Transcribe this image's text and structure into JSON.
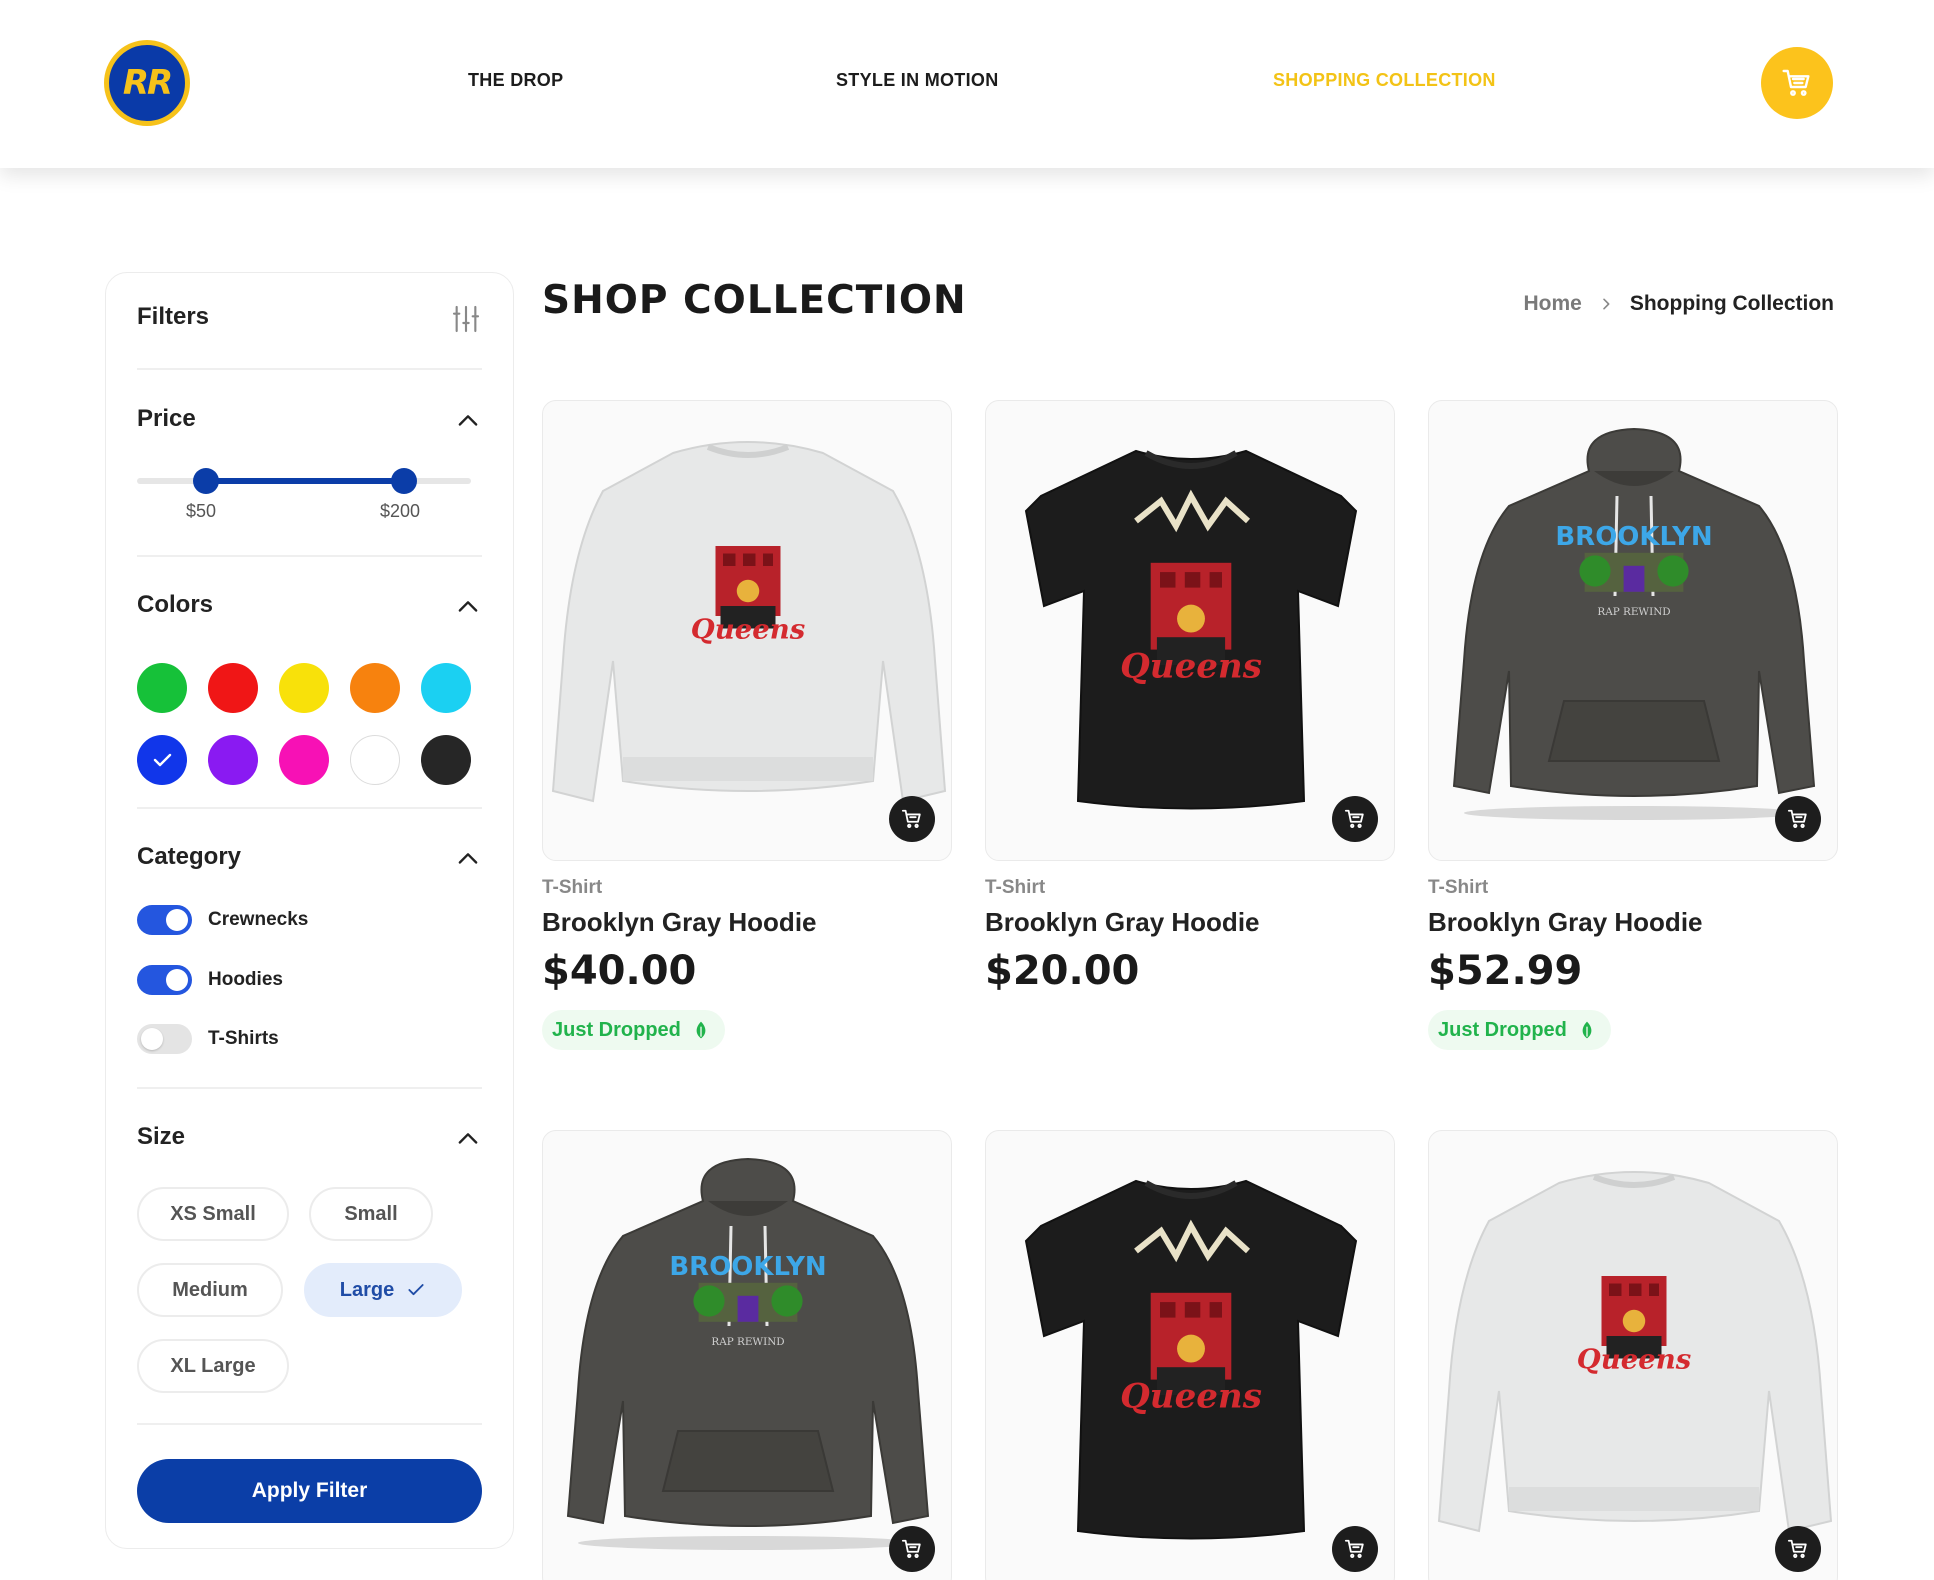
{
  "header": {
    "logo_text": "RR",
    "nav": [
      {
        "label": "THE DROP",
        "active": false
      },
      {
        "label": "STYLE IN MOTION",
        "active": false
      },
      {
        "label": "SHOPPING COLLECTION",
        "active": true
      }
    ],
    "cart_icon": "cart-icon",
    "accent_color": "#fcc31c"
  },
  "sidebar": {
    "title": "Filters",
    "filter_icon": "sliders-icon",
    "price": {
      "title": "Price",
      "min_label": "$50",
      "max_label": "$200"
    },
    "colors": {
      "title": "Colors",
      "swatches": [
        "#16c139",
        "#f01616",
        "#f8e10a",
        "#f7820e",
        "#1bd0f2",
        "#1136ea",
        "#8a1af2",
        "#f711b5",
        "#ffffff",
        "#262626"
      ],
      "selected": "#1136ea"
    },
    "category": {
      "title": "Category",
      "items": [
        {
          "label": "Crewnecks",
          "on": true
        },
        {
          "label": "Hoodies",
          "on": true
        },
        {
          "label": "T-Shirts",
          "on": false
        }
      ]
    },
    "size": {
      "title": "Size",
      "options": [
        "XS Small",
        "Small",
        "Medium",
        "Large",
        "XL Large"
      ],
      "selected": "Large"
    },
    "apply_label": "Apply Filter"
  },
  "main": {
    "title": "SHOP COLLECTION",
    "breadcrumb": {
      "home": "Home",
      "current": "Shopping Collection"
    },
    "products": [
      {
        "category": "T-Shirt",
        "name": "Brooklyn Gray Hoodie",
        "price": "$40.00",
        "badge": "Just Dropped",
        "garment": "crewneck-white"
      },
      {
        "category": "T-Shirt",
        "name": "Brooklyn Gray Hoodie",
        "price": "$20.00",
        "badge": "",
        "garment": "tshirt-black"
      },
      {
        "category": "T-Shirt",
        "name": "Brooklyn Gray Hoodie",
        "price": "$52.99",
        "badge": "Just Dropped",
        "garment": "hoodie-gray"
      },
      {
        "garment": "hoodie-gray"
      },
      {
        "garment": "tshirt-black"
      },
      {
        "garment": "crewneck-white"
      }
    ],
    "badge_color": "#21b34c",
    "brand_blue": "#0b3ea7"
  }
}
